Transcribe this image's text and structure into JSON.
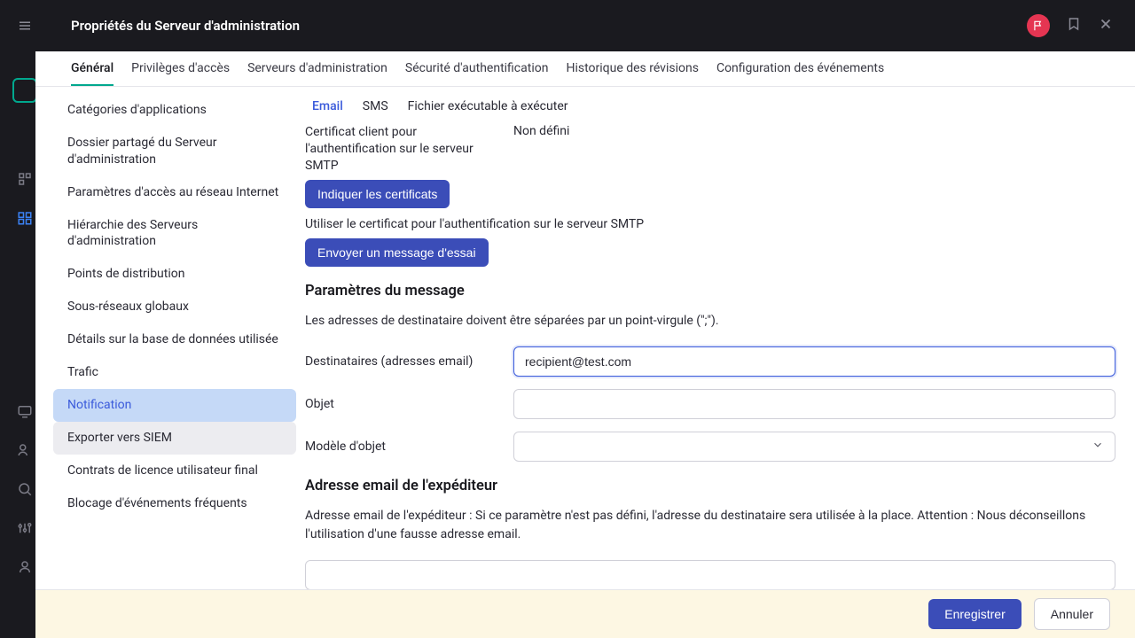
{
  "header": {
    "title": "Propriétés du Serveur d'administration"
  },
  "tabs": [
    {
      "label": "Général",
      "active": true
    },
    {
      "label": "Privilèges d'accès"
    },
    {
      "label": "Serveurs d'administration"
    },
    {
      "label": "Sécurité d'authentification"
    },
    {
      "label": "Historique des révisions"
    },
    {
      "label": "Configuration des événements"
    }
  ],
  "sidebar": {
    "items": [
      {
        "label": "Catégories d'applications"
      },
      {
        "label": "Dossier partagé du Serveur d'administration"
      },
      {
        "label": "Paramètres d'accès au réseau Internet"
      },
      {
        "label": "Hiérarchie des Serveurs d'administration"
      },
      {
        "label": "Points de distribution"
      },
      {
        "label": "Sous-réseaux globaux"
      },
      {
        "label": "Détails sur la base de données utilisée"
      },
      {
        "label": "Trafic"
      },
      {
        "label": "Notification",
        "active": true
      },
      {
        "label": "Exporter vers SIEM",
        "hover": true
      },
      {
        "label": "Contrats de licence utilisateur final"
      },
      {
        "label": "Blocage d'événements fréquents"
      }
    ]
  },
  "subtabs": [
    {
      "label": "Email",
      "active": true
    },
    {
      "label": "SMS"
    },
    {
      "label": "Fichier exécutable à exécuter"
    }
  ],
  "cert": {
    "label": "Certificat client pour l'authentification sur le serveur SMTP",
    "value": "Non défini",
    "button": "Indiquer les certificats",
    "use_cert_text": "Utiliser le certificat pour l'authentification sur le serveur SMTP",
    "test_button": "Envoyer un message d'essai"
  },
  "message_params": {
    "heading": "Paramètres du message",
    "helper": "Les adresses de destinataire doivent être séparées par un point-virgule (\";\").",
    "recipients_label": "Destinataires (adresses email)",
    "recipients_value": "recipient@test.com",
    "subject_label": "Objet",
    "subject_value": "",
    "template_label": "Modèle d'objet",
    "template_value": ""
  },
  "sender": {
    "heading": "Adresse email de l'expéditeur",
    "helper": "Adresse email de l'expéditeur : Si ce paramètre n'est pas défini, l'adresse du destinataire sera utilisée à la place. Attention : Nous déconseillons l'utilisation d'une fausse adresse email.",
    "value": ""
  },
  "footer": {
    "save": "Enregistrer",
    "cancel": "Annuler"
  }
}
